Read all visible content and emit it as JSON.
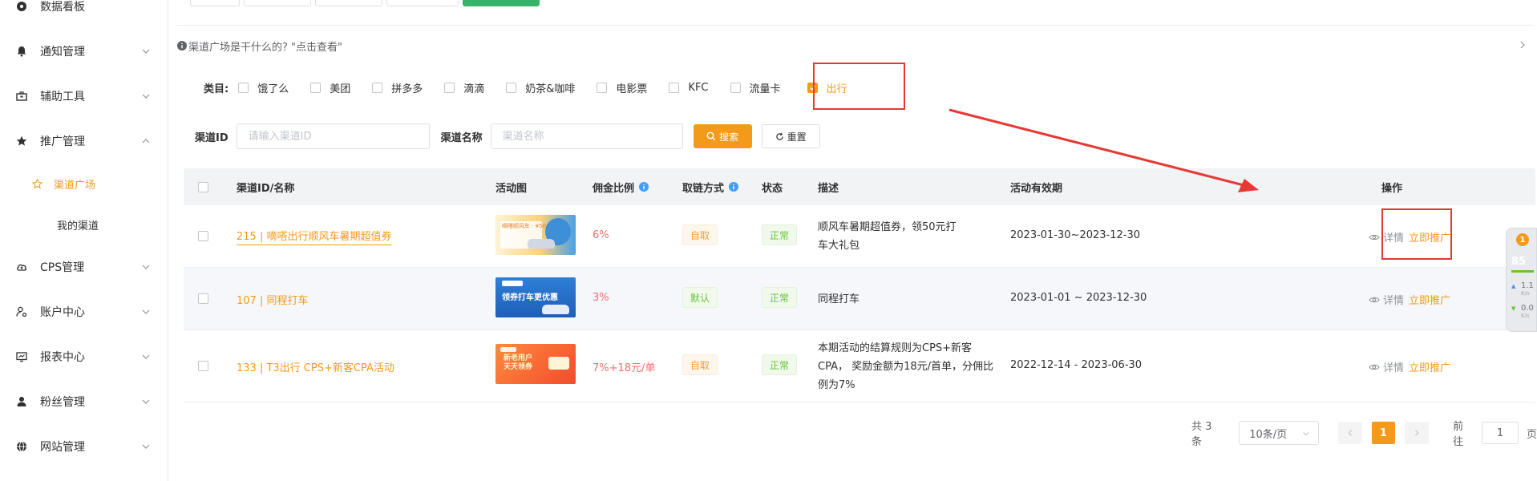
{
  "sidebar": {
    "items": [
      {
        "label": "数据看板",
        "icon": "dashboard-icon",
        "has_children": false
      },
      {
        "label": "通知管理",
        "icon": "bell-icon",
        "has_children": true
      },
      {
        "label": "辅助工具",
        "icon": "toolbox-icon",
        "has_children": true
      },
      {
        "label": "推广管理",
        "icon": "star-icon",
        "has_children": true,
        "expanded": true
      },
      {
        "label": "CPS管理",
        "icon": "cloud-icon",
        "has_children": true
      },
      {
        "label": "账户中心",
        "icon": "user-settings-icon",
        "has_children": true
      },
      {
        "label": "报表中心",
        "icon": "report-icon",
        "has_children": true
      },
      {
        "label": "粉丝管理",
        "icon": "user-icon",
        "has_children": true
      },
      {
        "label": "网站管理",
        "icon": "globe-icon",
        "has_children": true
      }
    ],
    "submenu": [
      {
        "label": "渠道广场",
        "active": true
      },
      {
        "label": "我的渠道",
        "active": false
      }
    ]
  },
  "notice": {
    "text": "渠道广场是干什么的? \"点击查看\""
  },
  "categories": {
    "label": "类目:",
    "items": [
      {
        "label": "饿了么",
        "checked": false
      },
      {
        "label": "美团",
        "checked": false
      },
      {
        "label": "拼多多",
        "checked": false
      },
      {
        "label": "滴滴",
        "checked": false
      },
      {
        "label": "奶茶&咖啡",
        "checked": false
      },
      {
        "label": "电影票",
        "checked": false
      },
      {
        "label": "KFC",
        "checked": false
      },
      {
        "label": "流量卡",
        "checked": false
      },
      {
        "label": "出行",
        "checked": true
      }
    ]
  },
  "search": {
    "id_label": "渠道ID",
    "id_placeholder": "请输入渠道ID",
    "name_label": "渠道名称",
    "name_placeholder": "渠道名称",
    "search_label": "搜索",
    "reset_label": "重置"
  },
  "table": {
    "headers": {
      "name": "渠道ID/名称",
      "image": "活动图",
      "ratio": "佣金比例",
      "link_method": "取链方式",
      "status": "状态",
      "desc": "描述",
      "period": "活动有效期",
      "actions": "操作"
    },
    "rows": [
      {
        "name": "215 | 嘀嗒出行顺风车暑期超值券",
        "image_text": "嘀嗒顺风车 · ¥50",
        "ratio": "6%",
        "link_method": "自取",
        "status": "正常",
        "desc": "顺风车暑期超值券，领50元打车大礼包",
        "period": "2023-01-30~2023-12-30",
        "detail": "详情",
        "promote": "立即推广"
      },
      {
        "name": "107 | 同程打车",
        "image_text": "领券打车更优惠",
        "ratio": "3%",
        "link_method": "默认",
        "status": "正常",
        "desc": "同程打车",
        "period": "2023-01-01 ~ 2023-12-30",
        "detail": "详情",
        "promote": "立即推广"
      },
      {
        "name": "133 | T3出行 CPS+新客CPA活动",
        "image_text": "新老用户 天天领券",
        "ratio": "7%+18元/单",
        "link_method": "自取",
        "status": "正常",
        "desc": "本期活动的结算规则为CPS+新客CPA， 奖励金额为18元/首单，分佣比例为7%",
        "period": "2022-12-14 - 2023-06-30",
        "detail": "详情",
        "promote": "立即推广"
      }
    ]
  },
  "pagination": {
    "total": "共 3 条",
    "page_size": "10条/页",
    "current_page": "1",
    "goto_prefix": "前往",
    "goto_value": "1",
    "goto_suffix": "页"
  },
  "widget": {
    "badge": "1",
    "value": "85",
    "up": "1.1",
    "up_unit": "K/s",
    "down": "0.0",
    "down_unit": "K/s"
  },
  "colors": {
    "accent": "#f39a1a",
    "annotation": "#e53935",
    "ratio": "#f56c6c",
    "status_green": "#67c23a"
  }
}
